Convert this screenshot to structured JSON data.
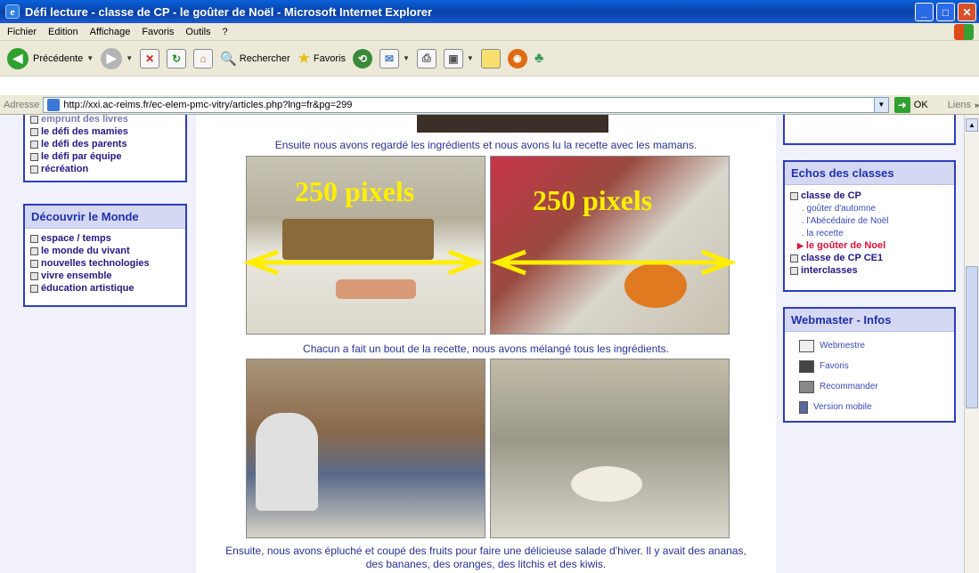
{
  "window": {
    "title": "Défi lecture - classe de CP - le goûter de Noël - Microsoft Internet Explorer"
  },
  "menu": [
    "Fichier",
    "Edition",
    "Affichage",
    "Favoris",
    "Outils",
    "?"
  ],
  "toolbar": {
    "back": "Précédente",
    "search": "Rechercher",
    "favorites": "Favoris"
  },
  "address": {
    "label": "Adresse",
    "url": "http://xxi.ac-reims.fr/ec-elem-pmc-vitry/articles.php?lng=fr&pg=299",
    "go": "OK",
    "links": "Liens"
  },
  "left": {
    "top_items": [
      "emprunt des livres",
      "le défi des mamies",
      "le défi des parents",
      "le défi par équipe",
      "récréation"
    ],
    "discover_title": "Découvrir le Monde",
    "discover_items": [
      "espace / temps",
      "le monde du vivant",
      "nouvelles technologies",
      "vivre ensemble",
      "éducation artistique"
    ]
  },
  "main": {
    "caption1": "Ensuite nous avons regardé les ingrédients et nous avons lu la recette avec les mamans.",
    "caption2": "Chacun a fait un bout de la recette, nous avons mélangé tous les ingrédients.",
    "caption3a": "Ensuite, nous avons épluché et coupé des fruits pour faire une délicieuse salade d'hiver. Il y avait des ananas,",
    "caption3b": "des bananes, des oranges, des litchis et des kiwis.",
    "overlay_left": "250 pixels",
    "overlay_right": "250 pixels"
  },
  "right": {
    "echos_title": "Echos des classes",
    "class_cp": "classe de CP",
    "cp_sub": [
      ". goûter d'automne",
      ". l'Abécédaire de Noël",
      ". la recette"
    ],
    "cp_current": "le goûter de Noel",
    "class_cpce1": "classe de CP CE1",
    "interclasses": "interclasses",
    "webmaster_title": "Webmaster - Infos",
    "wm_items": [
      "Webmestre",
      "Favoris",
      "Recommander",
      "Version mobile"
    ]
  },
  "colors": {
    "accent": "#2d3cc0",
    "link": "#241888",
    "current": "#e0103a",
    "overlay": "#ffee00"
  }
}
